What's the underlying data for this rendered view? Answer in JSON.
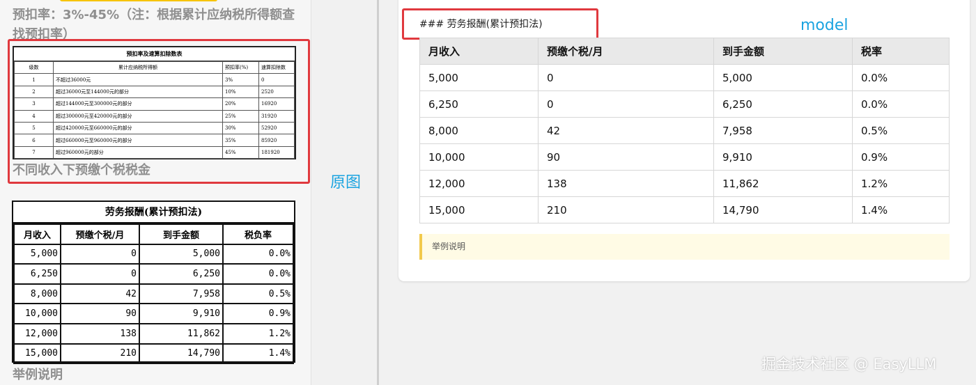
{
  "left": {
    "heading": "预扣率：3%-45%（注：根据累计应纳税所得额查找预扣率）",
    "rate_table": {
      "title": "预扣率及速算扣除数表",
      "headers": [
        "级数",
        "累计应纳税所得额",
        "预扣率(%)",
        "速算扣除数"
      ],
      "rows": [
        [
          "1",
          "不超过36000元",
          "3%",
          "0"
        ],
        [
          "2",
          "超过36000元至144000元的部分",
          "10%",
          "2520"
        ],
        [
          "3",
          "超过144000元至300000元的部分",
          "20%",
          "16920"
        ],
        [
          "4",
          "超过300000元至420000元的部分",
          "25%",
          "31920"
        ],
        [
          "5",
          "超过420000元至660000元的部分",
          "30%",
          "52920"
        ],
        [
          "6",
          "超过660000元至960000元的部分",
          "35%",
          "85920"
        ],
        [
          "7",
          "超过960000元的部分",
          "45%",
          "181920"
        ]
      ]
    },
    "subheading": "不同收入下预缴个税税金",
    "big_table": {
      "title": "劳务报酬(累计预扣法)",
      "headers": [
        "月收入",
        "预缴个税/月",
        "到手金额",
        "税负率"
      ],
      "rows": [
        [
          "5,000",
          "0",
          "5,000",
          "0.0%"
        ],
        [
          "6,250",
          "0",
          "6,250",
          "0.0%"
        ],
        [
          "8,000",
          "42",
          "7,958",
          "0.5%"
        ],
        [
          "10,000",
          "90",
          "9,910",
          "0.9%"
        ],
        [
          "12,000",
          "138",
          "11,862",
          "1.2%"
        ],
        [
          "15,000",
          "210",
          "14,790",
          "1.4%"
        ]
      ]
    },
    "footer": "举例说明"
  },
  "labels": {
    "original": "原图",
    "model": "model"
  },
  "right": {
    "md_heading": "### 劳务报酬(累计预扣法)",
    "table": {
      "headers": [
        "月收入",
        "预缴个税/月",
        "到手金额",
        "税率"
      ],
      "rows": [
        [
          "5,000",
          "0",
          "5,000",
          "0.0%"
        ],
        [
          "6,250",
          "0",
          "6,250",
          "0.0%"
        ],
        [
          "8,000",
          "42",
          "7,958",
          "0.5%"
        ],
        [
          "10,000",
          "90",
          "9,910",
          "0.9%"
        ],
        [
          "12,000",
          "138",
          "11,862",
          "1.2%"
        ],
        [
          "15,000",
          "210",
          "14,790",
          "1.4%"
        ]
      ]
    },
    "quote": "举例说明"
  },
  "watermark": "掘金技术社区 @ EasyLLM",
  "colors": {
    "highlight_box": "#e0393e",
    "label_blue": "#1aa3e0",
    "quote_bar": "#f2c94c"
  }
}
